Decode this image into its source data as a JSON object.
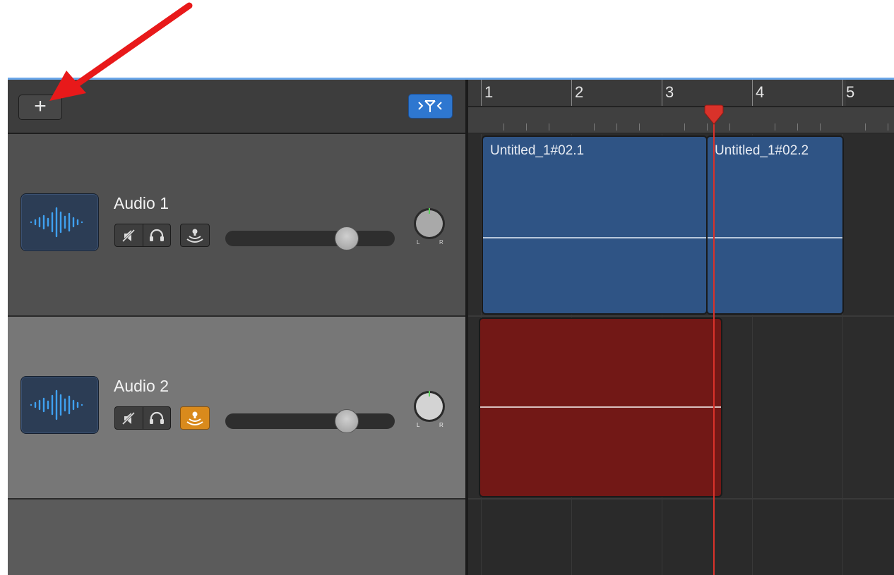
{
  "header": {
    "add_track_label": "+",
    "bar_numbers": [
      "1",
      "2",
      "3",
      "4",
      "5"
    ]
  },
  "tracks": [
    {
      "name": "Audio 1",
      "monitoring": false
    },
    {
      "name": "Audio 2",
      "monitoring": true
    }
  ],
  "regions": [
    {
      "label": "Untitled_1#02.1",
      "track": 1,
      "color": "#2f5485"
    },
    {
      "label": "Untitled_1#02.2",
      "track": 1,
      "color": "#2f5485"
    },
    {
      "label": "",
      "track": 2,
      "color": "#721816"
    }
  ],
  "pan_knob_labels": {
    "left": "L",
    "right": "R"
  },
  "colors": {
    "accent_blue": "#2e77d0",
    "monitor_active": "#d98a1c",
    "playhead": "#d9322a",
    "annotation_arrow": "#e8191a"
  },
  "icons": {
    "track_type": "waveform-icon",
    "filter": "track-filter-icon",
    "mute": "mute-icon",
    "solo": "headphones-icon",
    "monitor": "input-monitor-icon"
  }
}
